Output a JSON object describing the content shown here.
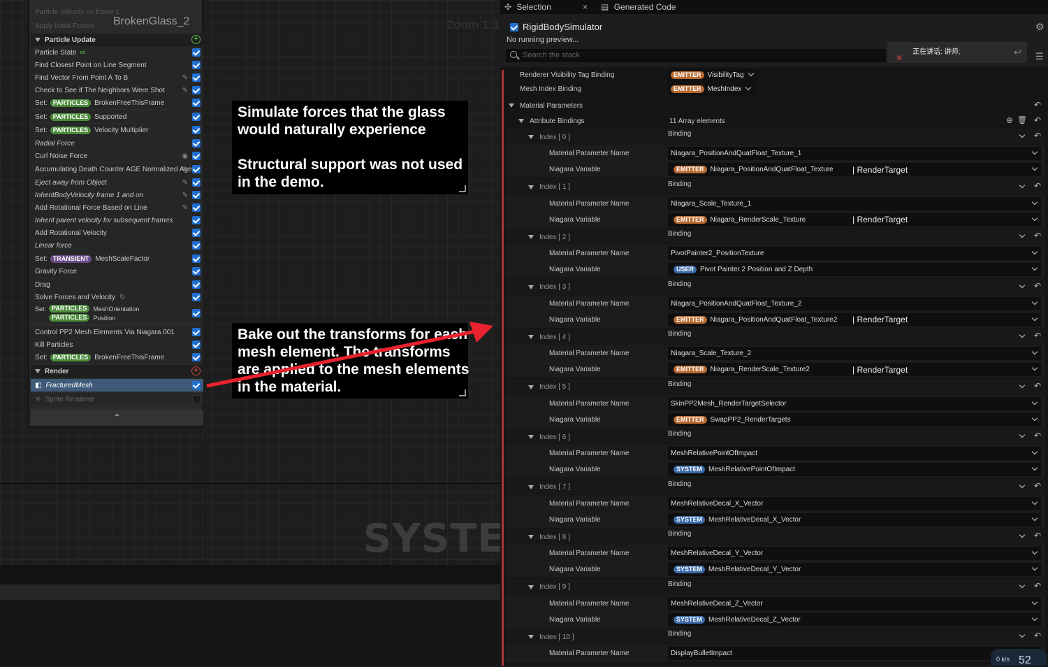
{
  "graph": {
    "zoom_label": "Zoom 1:1",
    "system_watermark": "SYSTEM",
    "stack_title": "BrokenGlass_2",
    "ghost_rows": [
      "Particle Velocity on frame 1",
      "Apply Initial Forces"
    ],
    "rows": [
      {
        "kind": "section",
        "text": "Particle Update",
        "icon": "plus"
      },
      {
        "text": "Particle State",
        "extra": "infinity",
        "checked": true
      },
      {
        "text": "Find Closest Point on Line Segment",
        "checked": true
      },
      {
        "text": "Find Vector From Point A To B",
        "checked": true,
        "icon": "edit"
      },
      {
        "text": "Check to See if The Neighbors Were Shot",
        "checked": true,
        "icon": "edit"
      },
      {
        "prefix": "Set:",
        "badge": "PARTICLES",
        "text": "BrokenFreeThisFrame",
        "checked": true
      },
      {
        "prefix": "Set:",
        "badge": "PARTICLES",
        "text": "Supported",
        "checked": true
      },
      {
        "prefix": "Set:",
        "badge": "PARTICLES",
        "text": "Velocity Multiplier",
        "checked": true
      },
      {
        "text": "Radial Force",
        "italic": true,
        "checked": true
      },
      {
        "text": "Curl Noise Force",
        "checked": true,
        "icon": "eye"
      },
      {
        "text": "Accumulating Death Counter AGE Normalized Age",
        "checked": true,
        "icon": "edit"
      },
      {
        "text": "Eject away from Object",
        "italic": true,
        "checked": true,
        "icon": "edit"
      },
      {
        "text": "InheritBodyVelocity frame 1 and on",
        "italic": true,
        "checked": true,
        "icon": "edit"
      },
      {
        "text": "Add Rotational Force Based on Line",
        "checked": true,
        "icon": "edit"
      },
      {
        "text": "Inherit parent velocity for subsequent frames",
        "italic": true,
        "checked": true
      },
      {
        "text": "Add Rotational Velocity",
        "checked": true
      },
      {
        "text": "Linear force",
        "italic": true,
        "checked": true
      },
      {
        "prefix": "Set:",
        "badge": "TRANSIENT",
        "text": "MeshScaleFactor",
        "checked": true
      },
      {
        "text": "Gravity Force",
        "checked": true
      },
      {
        "text": "Drag",
        "checked": true
      },
      {
        "text": "Solve Forces and Velocity",
        "checked": true,
        "extra": "loop"
      },
      {
        "prefix": "Set:",
        "badge": "PARTICLES",
        "text": "MeshOrientation",
        "badge2": "PARTICLES",
        "text2": "Position",
        "checked": true,
        "tall": true
      },
      {
        "text": "Control PP2 Mesh Elements Via Niagara 001",
        "checked": true
      },
      {
        "text": "Kill Particles",
        "checked": true
      },
      {
        "prefix": "Set:",
        "badge": "PARTICLES",
        "text": "BrokenFreeThisFrame",
        "checked": true
      },
      {
        "kind": "section",
        "text": "Render",
        "icon": "plus-red"
      },
      {
        "text": "FracturedMesh",
        "selected": true,
        "checked": true,
        "lead": "mesh"
      },
      {
        "text": "Sprite Renderer",
        "dim": true,
        "checked": false,
        "lead": "sprite"
      }
    ],
    "collapse_glyph": "⌃"
  },
  "notes": [
    {
      "lines": [
        "Simulate forces that the glass",
        "would naturally experience",
        "",
        "Structural support was not used",
        "in the demo."
      ]
    },
    {
      "lines": [
        "Bake out the transforms for each",
        "mesh element. The transforms",
        "are applied to the mesh elements",
        "in the material."
      ]
    }
  ],
  "colors": {
    "arrow": "#e8232f",
    "checkbox": "#1f6fd0",
    "emitter": "#b86a30",
    "system": "#3a6aa8",
    "particles": "#4a8a3a"
  },
  "panel": {
    "tabs": [
      {
        "label": "Selection",
        "icon": "selection-icon"
      },
      {
        "label": "Generated Code",
        "icon": "code-icon"
      }
    ],
    "tab_close": "×",
    "title": "RigidBodySimulator",
    "status": "No running preview...",
    "search_placeholder": "Search the stack",
    "voice_text": "正在讲话: 讲师;",
    "top_rows": [
      {
        "label": "Renderer Visibility Tag Binding",
        "badge": "EMITTER",
        "value": "VisibilityTag"
      },
      {
        "label": "Mesh Index Binding",
        "badge": "EMITTER",
        "value": "MeshIndex"
      }
    ],
    "material_params_label": "Material Parameters",
    "attribute_bindings_label": "Attribute Bindings",
    "attribute_bindings_count": "11 Array elements",
    "binding_label": "Binding",
    "mat_param_label": "Material Parameter Name",
    "niagara_var_label": "Niagara Variable",
    "indices": [
      {
        "idx": "Index [ 0 ]",
        "mat": "Niagara_PositionAndQuatFloat_Texture_1",
        "badge": "EMITTER",
        "var": "Niagara_PositionAndQuatFloat_Texture",
        "rt": "| RenderTarget"
      },
      {
        "idx": "Index [ 1 ]",
        "mat": "Niagara_Scale_Texture_1",
        "badge": "EMITTER",
        "var": "Niagara_RenderScale_Texture",
        "rt": "| RenderTarget"
      },
      {
        "idx": "Index [ 2 ]",
        "mat": "PivotPainter2_PositionTexture",
        "badge": "USER",
        "var": "Pivot Painter 2 Position and Z Depth",
        "rt": ""
      },
      {
        "idx": "Index [ 3 ]",
        "mat": "Niagara_PositionAndQuatFloat_Texture_2",
        "badge": "EMITTER",
        "var": "Niagara_PositionAndQuatFloat_Texture2",
        "rt": "| RenderTarget"
      },
      {
        "idx": "Index [ 4 ]",
        "mat": "Niagara_Scale_Texture_2",
        "badge": "EMITTER",
        "var": "Niagara_RenderScale_Texture2",
        "rt": "| RenderTarget"
      },
      {
        "idx": "Index [ 5 ]",
        "mat": "SkinPP2Mesh_RenderTargetSelector",
        "badge": "EMITTER",
        "var": "SwapPP2_RenderTargets",
        "rt": ""
      },
      {
        "idx": "Index [ 6 ]",
        "mat": "MeshRelativePointOfImpact",
        "badge": "SYSTEM",
        "var": "MeshRelativePointOfImpact",
        "rt": ""
      },
      {
        "idx": "Index [ 7 ]",
        "mat": "MeshRelativeDecal_X_Vector",
        "badge": "SYSTEM",
        "var": "MeshRelativeDecal_X_Vector",
        "rt": ""
      },
      {
        "idx": "Index [ 8 ]",
        "mat": "MeshRelativeDecal_Y_Vector",
        "badge": "SYSTEM",
        "var": "MeshRelativeDecal_Y_Vector",
        "rt": ""
      },
      {
        "idx": "Index [ 9 ]",
        "mat": "MeshRelativeDecal_Z_Vector",
        "badge": "SYSTEM",
        "var": "MeshRelativeDecal_Z_Vector",
        "rt": ""
      },
      {
        "idx": "Index [ 10 ]",
        "mat": "DisplayBulletImpact",
        "badge": "",
        "var": "",
        "rt": ""
      }
    ],
    "fps_value": "52",
    "fps_unit": "0 k/s"
  }
}
